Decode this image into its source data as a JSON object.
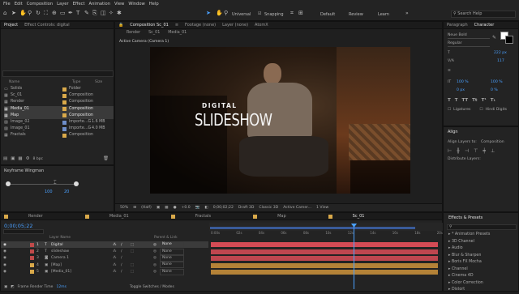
{
  "menu": [
    "File",
    "Edit",
    "Composition",
    "Layer",
    "Effect",
    "Animation",
    "View",
    "Window",
    "Help"
  ],
  "toolbar": {
    "universal": "Universal",
    "snapping": "Snapping",
    "workspaces": [
      "Default",
      "Review",
      "Learn"
    ],
    "search_placeholder": "Search Help"
  },
  "project": {
    "tab": "Project",
    "effect_controls": "Effect Controls: digital",
    "columns": {
      "name": "Name",
      "type": "Type",
      "size": "Size"
    },
    "items": [
      {
        "name": "Solids",
        "type": "Folder",
        "size": "",
        "color": "#d9a94a"
      },
      {
        "name": "Sc_01",
        "type": "Composition",
        "size": "",
        "color": "#d9a94a"
      },
      {
        "name": "Render",
        "type": "Composition",
        "size": "",
        "color": "#d9a94a"
      },
      {
        "name": "Media_01",
        "type": "Composition",
        "size": "",
        "color": "#d9a94a"
      },
      {
        "name": "Map",
        "type": "Composition",
        "size": "",
        "color": "#d9a94a"
      },
      {
        "name": "Image_02",
        "type": "Importe...G",
        "size": "1.6 MB",
        "color": "#6e8ec9"
      },
      {
        "name": "Image_01",
        "type": "Importe...G",
        "size": "4.0 MB",
        "color": "#6e8ec9"
      },
      {
        "name": "Fractals",
        "type": "Composition",
        "size": "",
        "color": "#d9a94a"
      }
    ],
    "bpc": "8 bpc"
  },
  "wingman": {
    "title": "Keyframe Wingman",
    "value_a": "100",
    "value_b": "20"
  },
  "comp_panel": {
    "tab": "Composition Sc_01",
    "footage": "Footage (none)",
    "layer": "Layer (none)",
    "atomx": "AtomX",
    "breadcrumbs": [
      "Render",
      "Sc_01",
      "Media_01"
    ],
    "camera_label": "Active Camera (Camera 1)",
    "title_small": "DIGITAL",
    "title_big": "SLIDESHOW"
  },
  "viewer_bar": {
    "zoom": "50%",
    "res": "(Half)",
    "exposure": "+0.0",
    "time": "0;00;02;22",
    "draft": "Draft 3D",
    "renderer": "Classic 3D",
    "camera": "Active Camer...",
    "views": "1 View"
  },
  "character": {
    "tabs": [
      "Paragraph",
      "Character"
    ],
    "font": "Neue Bold",
    "style": "Regular",
    "size": "222 px",
    "leading": "117",
    "tracking_v": "100 %",
    "tracking_h": "100 %",
    "baseline": "0 px",
    "percent": "0 %",
    "ligatures": "Ligatures",
    "hindi": "Hindi Digits"
  },
  "align": {
    "title": "Align",
    "align_to_label": "Align Layers to:",
    "align_to": "Composition",
    "distribute": "Distribute Layers:"
  },
  "timeline": {
    "tabs": [
      {
        "name": "Render",
        "color": "#d9a94a"
      },
      {
        "name": "Media_01",
        "color": "#d9a94a"
      },
      {
        "name": "Fractals",
        "color": "#d9a94a"
      },
      {
        "name": "Map",
        "color": "#d9a94a"
      },
      {
        "name": "Sc_01",
        "color": "#d9a94a"
      }
    ],
    "timecode": "0;00;05;22",
    "col_layer": "Layer Name",
    "col_parent": "Parent & Link",
    "layers": [
      {
        "num": "1",
        "name": "Digital",
        "parent": "None",
        "color": "#c04a4a",
        "bar": "#d44b55"
      },
      {
        "num": "2",
        "name": "slideshow",
        "parent": "None",
        "color": "#c04a4a",
        "bar": "#d44b55"
      },
      {
        "num": "3",
        "name": "Camera 1",
        "parent": "None",
        "color": "#c04a4a",
        "bar": "#d44b55"
      },
      {
        "num": "4",
        "name": "[Map]",
        "parent": "None",
        "color": "#d9a94a",
        "bar": "#c8903a"
      },
      {
        "num": "5",
        "name": "[Media_01]",
        "parent": "None",
        "color": "#d9a94a",
        "bar": "#c8903a"
      }
    ],
    "ruler": [
      "0:00s",
      "02s",
      "04s",
      "06s",
      "08s",
      "10s",
      "12s",
      "14s",
      "16s",
      "18s",
      "20s"
    ],
    "footer_time": "Frame Render Time",
    "render_ms": "12ms",
    "toggle": "Toggle Switches / Modes"
  },
  "effects": {
    "title": "Effects & Presets",
    "search_placeholder": "",
    "items": [
      "* Animation Presets",
      "3D Channel",
      "Audio",
      "Blur & Sharpen",
      "Boris FX Mocha",
      "Channel",
      "Cinema 4D",
      "Color Correction",
      "Distort"
    ]
  }
}
